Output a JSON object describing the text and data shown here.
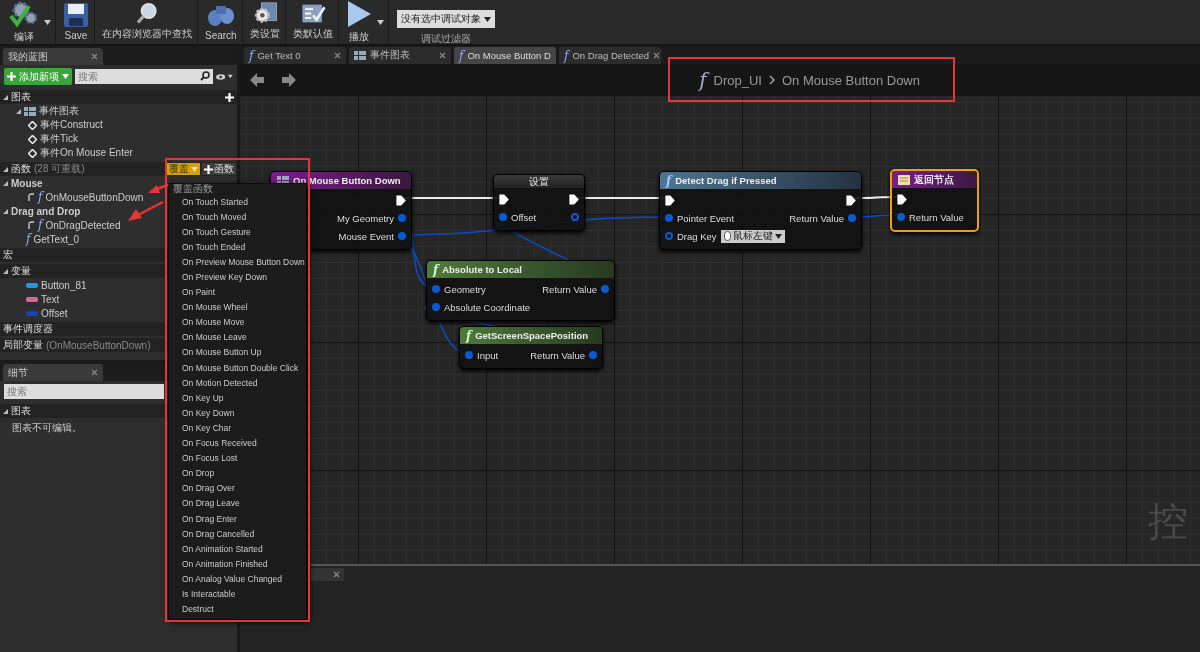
{
  "toolbar": {
    "buttons": [
      {
        "label": "编译",
        "has_menu": true
      },
      {
        "label": "Save",
        "has_menu": false
      },
      {
        "label": "在内容浏览器中查找",
        "has_menu": false
      },
      {
        "label": "Search",
        "has_menu": false
      },
      {
        "label": "类设置",
        "has_menu": false
      },
      {
        "label": "类默认值",
        "has_menu": false
      },
      {
        "label": "播放",
        "has_menu": true
      }
    ],
    "debug_filter": {
      "value": "没有选中调试对象",
      "label": "调试过滤器"
    }
  },
  "my_blueprint": {
    "tab": {
      "label": "我的蓝图",
      "closable": true
    },
    "add_button": "添加新项",
    "search": {
      "placeholder": "搜索"
    },
    "sections": [
      {
        "title": "图表",
        "expanded": true,
        "can_add": true,
        "items": [
          {
            "label": "事件图表",
            "kind": "graph",
            "expanded": true,
            "children": [
              {
                "label": "事件Construct",
                "kind": "event"
              },
              {
                "label": "事件Tick",
                "kind": "event"
              },
              {
                "label": "事件On Mouse Enter",
                "kind": "event"
              }
            ]
          }
        ]
      },
      {
        "title": "函数",
        "note": "(28 可重载)",
        "expanded": true,
        "override_button": "覆盖",
        "add_button": "函数",
        "items": [
          {
            "label": "Mouse",
            "kind": "category",
            "expanded": true,
            "children": [
              {
                "label": "OnMouseButtonDown",
                "kind": "override",
                "glyph": "f"
              }
            ]
          },
          {
            "label": "Drag and Drop",
            "kind": "category",
            "expanded": true,
            "children": [
              {
                "label": "OnDragDetected",
                "kind": "override",
                "glyph": "f"
              }
            ]
          },
          {
            "label": "GetText_0",
            "kind": "function",
            "glyph": "f"
          }
        ]
      },
      {
        "title": "宏"
      },
      {
        "title": "变量",
        "expanded": true,
        "items": [
          {
            "label": "Button_81",
            "kind": "variable",
            "color": "#1e9be0"
          },
          {
            "label": "Text",
            "kind": "variable",
            "color": "#e0609a"
          },
          {
            "label": "Offset",
            "kind": "variable",
            "color": "#1a3fc0"
          }
        ]
      },
      {
        "title": "事件调度器"
      },
      {
        "title": "局部变量",
        "note": "(OnMouseButtonDown)"
      }
    ]
  },
  "details": {
    "tab": {
      "label": "细节",
      "closable": true
    },
    "search": {
      "placeholder": "搜索"
    },
    "sections": [
      {
        "title": "图表",
        "expanded": true,
        "text": "图表不可编辑。"
      }
    ]
  },
  "graph_tabs": [
    {
      "label": "Get Text 0",
      "kind": "function",
      "glyph": "f",
      "selected": false,
      "closable": true
    },
    {
      "label": "事件图表",
      "kind": "graph",
      "selected": false,
      "closable": true
    },
    {
      "label": "On Mouse Button D",
      "kind": "function",
      "glyph": "f",
      "selected": true,
      "closable": false
    },
    {
      "label": "On Drag Detected",
      "kind": "function",
      "glyph": "f",
      "selected": false,
      "closable": true
    }
  ],
  "breadcrumb": {
    "glyph": "f",
    "parts": [
      "Drop_UI",
      "On Mouse Button Down"
    ]
  },
  "nodes": [
    {
      "title": "On Mouse Button Down",
      "kind": "event",
      "selected": false,
      "exec_in": false,
      "exec_out": true,
      "outputs": [
        {
          "label": "My Geometry",
          "connected": true
        },
        {
          "label": "Mouse Event",
          "connected": true
        }
      ]
    },
    {
      "title": "设置",
      "kind": "set",
      "selected": false,
      "exec_in": true,
      "exec_out": true,
      "inputs": [
        {
          "label": "Offset",
          "connected": true
        }
      ],
      "outputs": [
        {
          "connected": false
        }
      ]
    },
    {
      "title": "Detect Drag if Pressed",
      "kind": "function",
      "glyph": "f",
      "selected": false,
      "exec_in": true,
      "exec_out": true,
      "inputs": [
        {
          "label": "Pointer Event",
          "connected": true
        },
        {
          "label": "Drag Key",
          "connected": false,
          "value": "鼠标左键"
        }
      ],
      "outputs": [
        {
          "label": "Return Value",
          "connected": true
        }
      ]
    },
    {
      "title": "返回节点",
      "kind": "return",
      "selected": true,
      "exec_in": true,
      "exec_out": false,
      "inputs": [
        {
          "label": "Return Value",
          "connected": true
        }
      ]
    },
    {
      "title": "Absolute to Local",
      "kind": "pure",
      "glyph": "f",
      "selected": false,
      "exec_in": false,
      "exec_out": false,
      "inputs": [
        {
          "label": "Geometry",
          "connected": true
        },
        {
          "label": "Absolute Coordinate",
          "connected": true
        }
      ],
      "outputs": [
        {
          "label": "Return Value",
          "connected": true
        }
      ]
    },
    {
      "title": "GetScreenSpacePosition",
      "kind": "pure",
      "glyph": "f",
      "selected": false,
      "exec_in": false,
      "exec_out": false,
      "inputs": [
        {
          "label": "Input",
          "connected": true
        }
      ],
      "outputs": [
        {
          "label": "Return Value",
          "connected": true
        }
      ]
    }
  ],
  "graph_watermark": "控",
  "override_menu": {
    "heading": "覆盖函数",
    "items": [
      "On Touch Started",
      "On Touch Moved",
      "On Touch Gesture",
      "On Touch Ended",
      "On Preview Mouse Button Down",
      "On Preview Key Down",
      "On Paint",
      "On Mouse Wheel",
      "On Mouse Move",
      "On Mouse Leave",
      "On Mouse Button Up",
      "On Mouse Button Double Click",
      "On Motion Detected",
      "On Key Up",
      "On Key Down",
      "On Key Char",
      "On Focus Received",
      "On Focus Lost",
      "On Drop",
      "On Drag Over",
      "On Drag Leave",
      "On Drag Enter",
      "On Drag Cancelled",
      "On Animation Started",
      "On Animation Finished",
      "On Analog Value Changed",
      "Is Interactable",
      "Destruct"
    ]
  }
}
